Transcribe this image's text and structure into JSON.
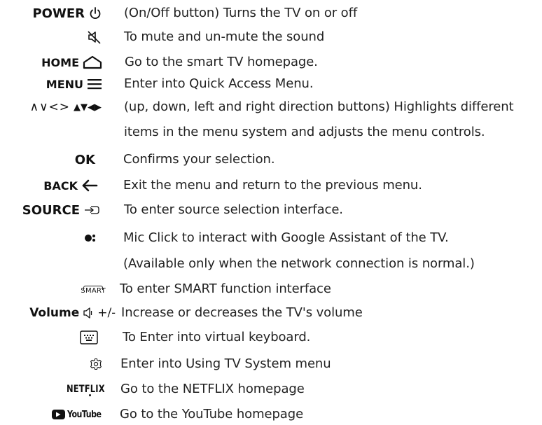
{
  "rows": [
    {
      "key": "POWER",
      "desc": "(On/Off button) Turns the TV on or off"
    },
    {
      "key": "",
      "desc": "To mute and un-mute the sound"
    },
    {
      "key": "HOME",
      "desc": "Go to the smart TV homepage."
    },
    {
      "key": "MENU",
      "desc": "Enter into Quick Access Menu."
    },
    {
      "key_thin": "∧∨<>",
      "key_solid": "▲▼◀▶",
      "desc": "(up, down, left and right direction buttons) Highlights different"
    },
    {
      "key": "",
      "desc": "items in the menu system and adjusts the menu controls."
    },
    {
      "key": "OK",
      "desc": "Confirms your selection."
    },
    {
      "key": "BACK",
      "desc": "Exit the menu and return to the previous menu."
    },
    {
      "key": "SOURCE",
      "desc": "To enter source selection interface."
    },
    {
      "key": "",
      "desc": "Mic Click to interact with Google Assistant of the TV."
    },
    {
      "key": "",
      "desc": "(Available only when the network connection is normal.)"
    },
    {
      "key": "SMART",
      "desc": "To enter SMART function interface"
    },
    {
      "key": "Volume",
      "suffix": "+/-",
      "desc": "Increase or decreases the TV's volume"
    },
    {
      "key": "",
      "desc": "To Enter into virtual keyboard."
    },
    {
      "key": "",
      "desc": "Enter into Using TV System menu"
    },
    {
      "key": "NETFLIX",
      "desc": "Go to the NETFLIX homepage"
    },
    {
      "key": "YouTube",
      "desc": "Go to the YouTube homepage"
    }
  ]
}
